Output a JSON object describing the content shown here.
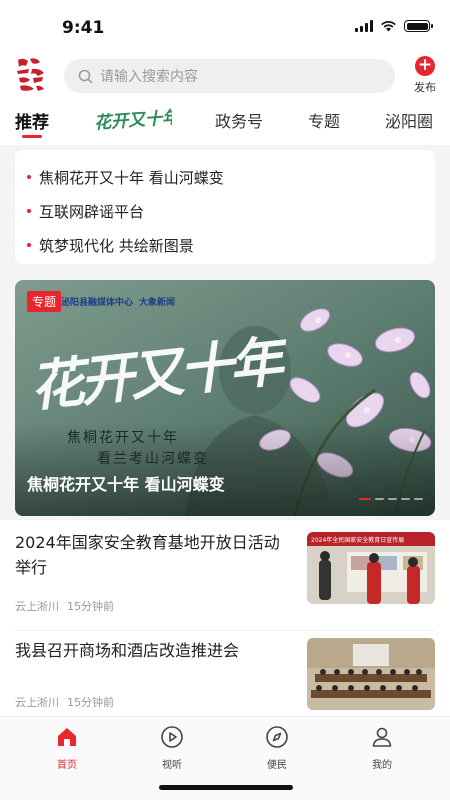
{
  "status_bar": {
    "time": "9:41"
  },
  "header": {
    "search_placeholder": "请输入搜索内容",
    "publish_label": "发布",
    "publish_symbol": "+"
  },
  "tabs": [
    {
      "label": "推荐",
      "active": true
    },
    {
      "label": "花开又十年",
      "active": false
    },
    {
      "label": "政务号",
      "active": false
    },
    {
      "label": "专题",
      "active": false
    },
    {
      "label": "泌阳圈",
      "active": false
    }
  ],
  "headlines": [
    "焦桐花开又十年 看山河蝶变",
    "互联网辟谣平台",
    "筑梦现代化 共绘新图景"
  ],
  "banner": {
    "tag": "专题",
    "brand_1": "泌阳县融媒体中心",
    "brand_2": "大象新闻",
    "calligraphy": "花开又十年",
    "subtitle_1": "焦桐花开又十年",
    "subtitle_2": "看兰考山河蝶变",
    "caption": "焦桐花开又十年 看山河蝶变"
  },
  "news": [
    {
      "title": "2024年国家安全教育基地开放日活动举行",
      "source": "云上淅川",
      "time": "15分钟前",
      "thumb_banner": "2024年全民国家安全教育日宣传展"
    },
    {
      "title": "我县召开商场和酒店改造推进会",
      "source": "云上淅川",
      "time": "15分钟前"
    }
  ],
  "bottom_nav": [
    {
      "label": "首页",
      "icon": "home-icon",
      "active": true
    },
    {
      "label": "视听",
      "icon": "play-icon",
      "active": false
    },
    {
      "label": "便民",
      "icon": "compass-icon",
      "active": false
    },
    {
      "label": "我的",
      "icon": "profile-icon",
      "active": false
    }
  ],
  "colors": {
    "accent": "#e8262d",
    "background": "#f4f4f4"
  }
}
